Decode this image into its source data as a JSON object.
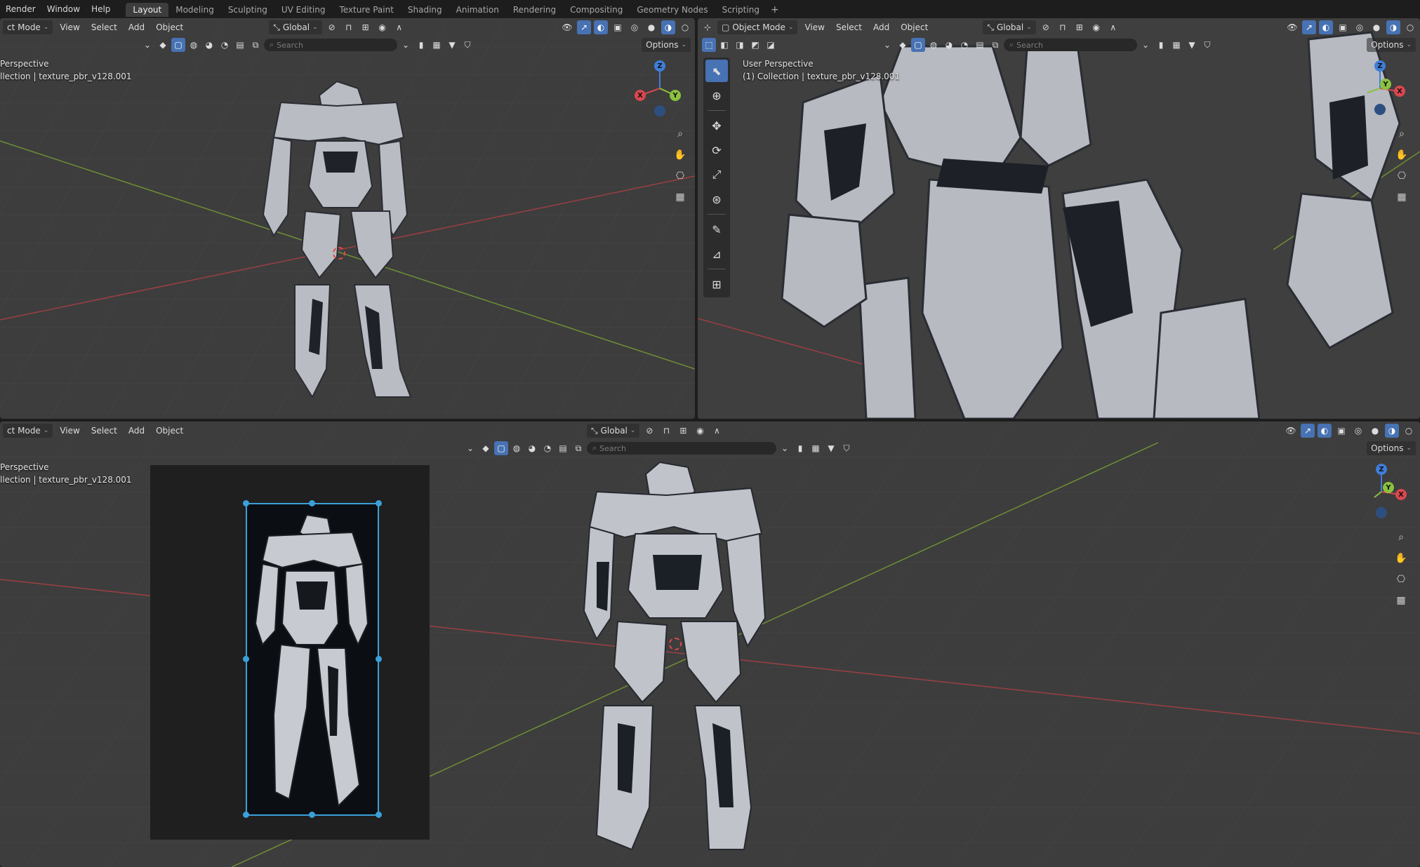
{
  "menu": [
    "Render",
    "Window",
    "Help"
  ],
  "workspaces": [
    "Layout",
    "Modeling",
    "Sculpting",
    "UV Editing",
    "Texture Paint",
    "Shading",
    "Animation",
    "Rendering",
    "Compositing",
    "Geometry Nodes",
    "Scripting"
  ],
  "active_workspace": "Layout",
  "add_tab_symbol": "+",
  "viewport_tl": {
    "mode": "ct Mode",
    "menus": [
      "View",
      "Select",
      "Add",
      "Object"
    ],
    "orientation": "Global",
    "search_placeholder": "Search",
    "options": "Options",
    "info_line1": "Perspective",
    "info_line2": "llection | texture_pbr_v128.001"
  },
  "viewport_tr": {
    "mode": "Object Mode",
    "menus": [
      "View",
      "Select",
      "Add",
      "Object"
    ],
    "orientation": "Global",
    "search_placeholder": "Search",
    "options": "Options",
    "info_line1": "User Perspective",
    "info_line2": "(1) Collection | texture_pbr_v128.001"
  },
  "viewport_bottom": {
    "mode": "ct Mode",
    "menus": [
      "View",
      "Select",
      "Add",
      "Object"
    ],
    "orientation": "Global",
    "search_placeholder": "Search",
    "options": "Options",
    "info_line1": "Perspective",
    "info_line2": "llection | texture_pbr_v128.001"
  },
  "gizmo_labels": {
    "x": "X",
    "y": "Y",
    "z": "Z"
  },
  "colors": {
    "viewport_bg": "#3d3d3d",
    "topbar_bg": "#1d1d1d",
    "accent_blue": "#4772b3",
    "x_axis": "#d9474f",
    "y_axis": "#8ac23f",
    "z_axis": "#3f7ed9",
    "reference_frame": "#3aa0d8"
  },
  "icons": {
    "tool_select": "cursor-select-icon",
    "tool_cursor": "3d-cursor-icon",
    "tool_move": "move-icon",
    "tool_rotate": "rotate-icon",
    "tool_scale": "scale-icon",
    "tool_transform": "transform-icon",
    "tool_annotate": "annotate-icon",
    "tool_measure": "measure-icon",
    "tool_add_cube": "add-cube-icon",
    "nav_zoom": "zoom-icon",
    "nav_pan": "hand-icon",
    "nav_camera": "camera-icon",
    "nav_ortho": "grid-ortho-icon"
  }
}
